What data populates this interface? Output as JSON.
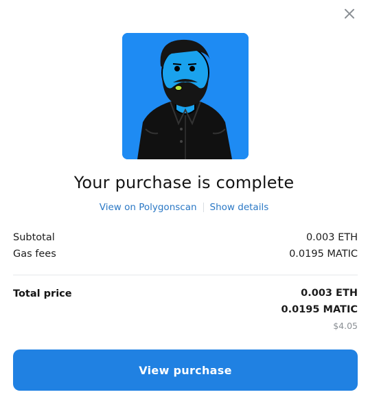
{
  "modal": {
    "close_icon": "close-icon",
    "nft_image": "bearded-character-nft",
    "title": "Your purchase is complete",
    "links": {
      "view_on_scan": "View on Polygonscan",
      "show_details": "Show details"
    },
    "breakdown": {
      "subtotal_label": "Subtotal",
      "subtotal_value": "0.003 ETH",
      "gas_label": "Gas fees",
      "gas_value": "0.0195 MATIC"
    },
    "total": {
      "label": "Total price",
      "eth": "0.003 ETH",
      "matic": "0.0195 MATIC",
      "usd": "$4.05"
    },
    "button_label": "View purchase"
  },
  "colors": {
    "accent": "#2081e2",
    "link": "#2a78c5",
    "avatar_bg": "#1e8bf3"
  }
}
